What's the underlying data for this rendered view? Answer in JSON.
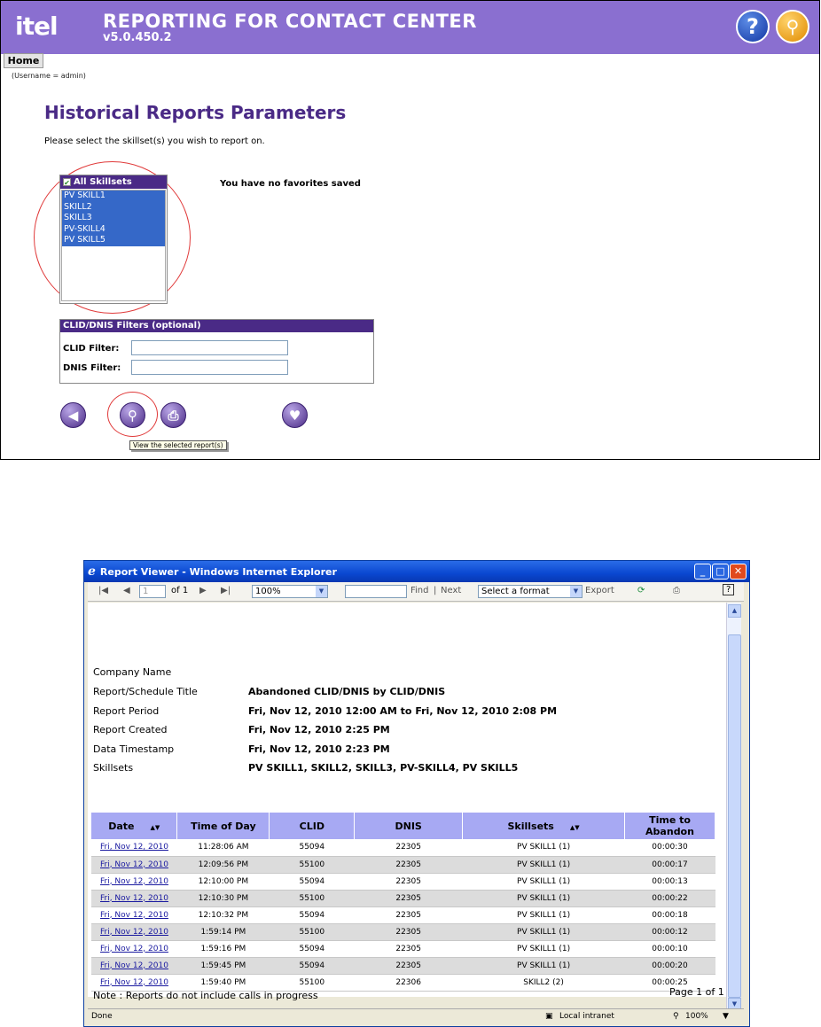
{
  "app": {
    "logo": "itel",
    "title": "REPORTING FOR CONTACT CENTER",
    "version": "v5.0.450.2",
    "help_icon": "?",
    "home_tab": "Home",
    "username": "(Username = admin)",
    "heading": "Historical Reports Parameters",
    "instructions": "Please select the skillset(s) you wish to report on.",
    "skillsets_header": "All Skillsets",
    "skillsets": [
      "PV SKILL1",
      "SKILL2",
      "SKILL3",
      "PV-SKILL4",
      "PV SKILL5"
    ],
    "favorites_message": "You have no favorites saved",
    "filters": {
      "header": "CLID/DNIS Filters (optional)",
      "clid_label": "CLID Filter:",
      "dnis_label": "DNIS Filter:",
      "clid_value": "",
      "dnis_value": ""
    },
    "tooltip": "View the selected report(s)",
    "icons": [
      "back-icon",
      "magnifier-icon",
      "print-icon",
      "favorite-add-icon",
      "help-icon",
      "key-icon"
    ]
  },
  "viewer": {
    "window_title": "Report Viewer - Windows Internet Explorer",
    "toolbar": {
      "page_value": "1",
      "page_of": "of 1",
      "zoom": "100%",
      "find": "Find",
      "separator": "|",
      "next": "Next",
      "format": "Select a format",
      "export": "Export"
    },
    "meta": [
      {
        "label": "Company Name",
        "value": ""
      },
      {
        "label": "Report/Schedule Title",
        "value": "Abandoned CLID/DNIS by CLID/DNIS"
      },
      {
        "label": "Report Period",
        "value": "Fri, Nov 12, 2010 12:00 AM to Fri, Nov 12, 2010 2:08 PM"
      },
      {
        "label": "Report Created",
        "value": "Fri, Nov 12, 2010 2:25 PM"
      },
      {
        "label": "Data Timestamp",
        "value": "Fri, Nov 12, 2010 2:23 PM"
      },
      {
        "label": "Skillsets",
        "value": "PV SKILL1, SKILL2, SKILL3, PV-SKILL4, PV SKILL5"
      }
    ],
    "columns": [
      "Date",
      "Time of Day",
      "CLID",
      "DNIS",
      "Skillsets",
      "Time to Abandon"
    ],
    "rows": [
      [
        "Fri, Nov 12, 2010",
        "11:28:06 AM",
        "55094",
        "22305",
        "PV SKILL1 (1)",
        "00:00:30"
      ],
      [
        "Fri, Nov 12, 2010",
        "12:09:56 PM",
        "55100",
        "22305",
        "PV SKILL1 (1)",
        "00:00:17"
      ],
      [
        "Fri, Nov 12, 2010",
        "12:10:00 PM",
        "55094",
        "22305",
        "PV SKILL1 (1)",
        "00:00:13"
      ],
      [
        "Fri, Nov 12, 2010",
        "12:10:30 PM",
        "55100",
        "22305",
        "PV SKILL1 (1)",
        "00:00:22"
      ],
      [
        "Fri, Nov 12, 2010",
        "12:10:32 PM",
        "55094",
        "22305",
        "PV SKILL1 (1)",
        "00:00:18"
      ],
      [
        "Fri, Nov 12, 2010",
        "1:59:14 PM",
        "55100",
        "22305",
        "PV SKILL1 (1)",
        "00:00:12"
      ],
      [
        "Fri, Nov 12, 2010",
        "1:59:16 PM",
        "55094",
        "22305",
        "PV SKILL1 (1)",
        "00:00:10"
      ],
      [
        "Fri, Nov 12, 2010",
        "1:59:45 PM",
        "55094",
        "22305",
        "PV SKILL1 (1)",
        "00:00:20"
      ],
      [
        "Fri, Nov 12, 2010",
        "1:59:40 PM",
        "55100",
        "22306",
        "SKILL2 (2)",
        "00:00:25"
      ]
    ],
    "note": "Note : Reports do not include calls in progress",
    "pager": "Page 1 of 1",
    "status": {
      "left": "Done",
      "zone": "Local intranet",
      "zoom": "100%"
    }
  },
  "colors": {
    "brand": "#8a6fd0",
    "heading": "#4a2a86",
    "selection": "#3568c8",
    "table_header": "#a7a9f3",
    "annotation_circle": "#e03a3a"
  }
}
